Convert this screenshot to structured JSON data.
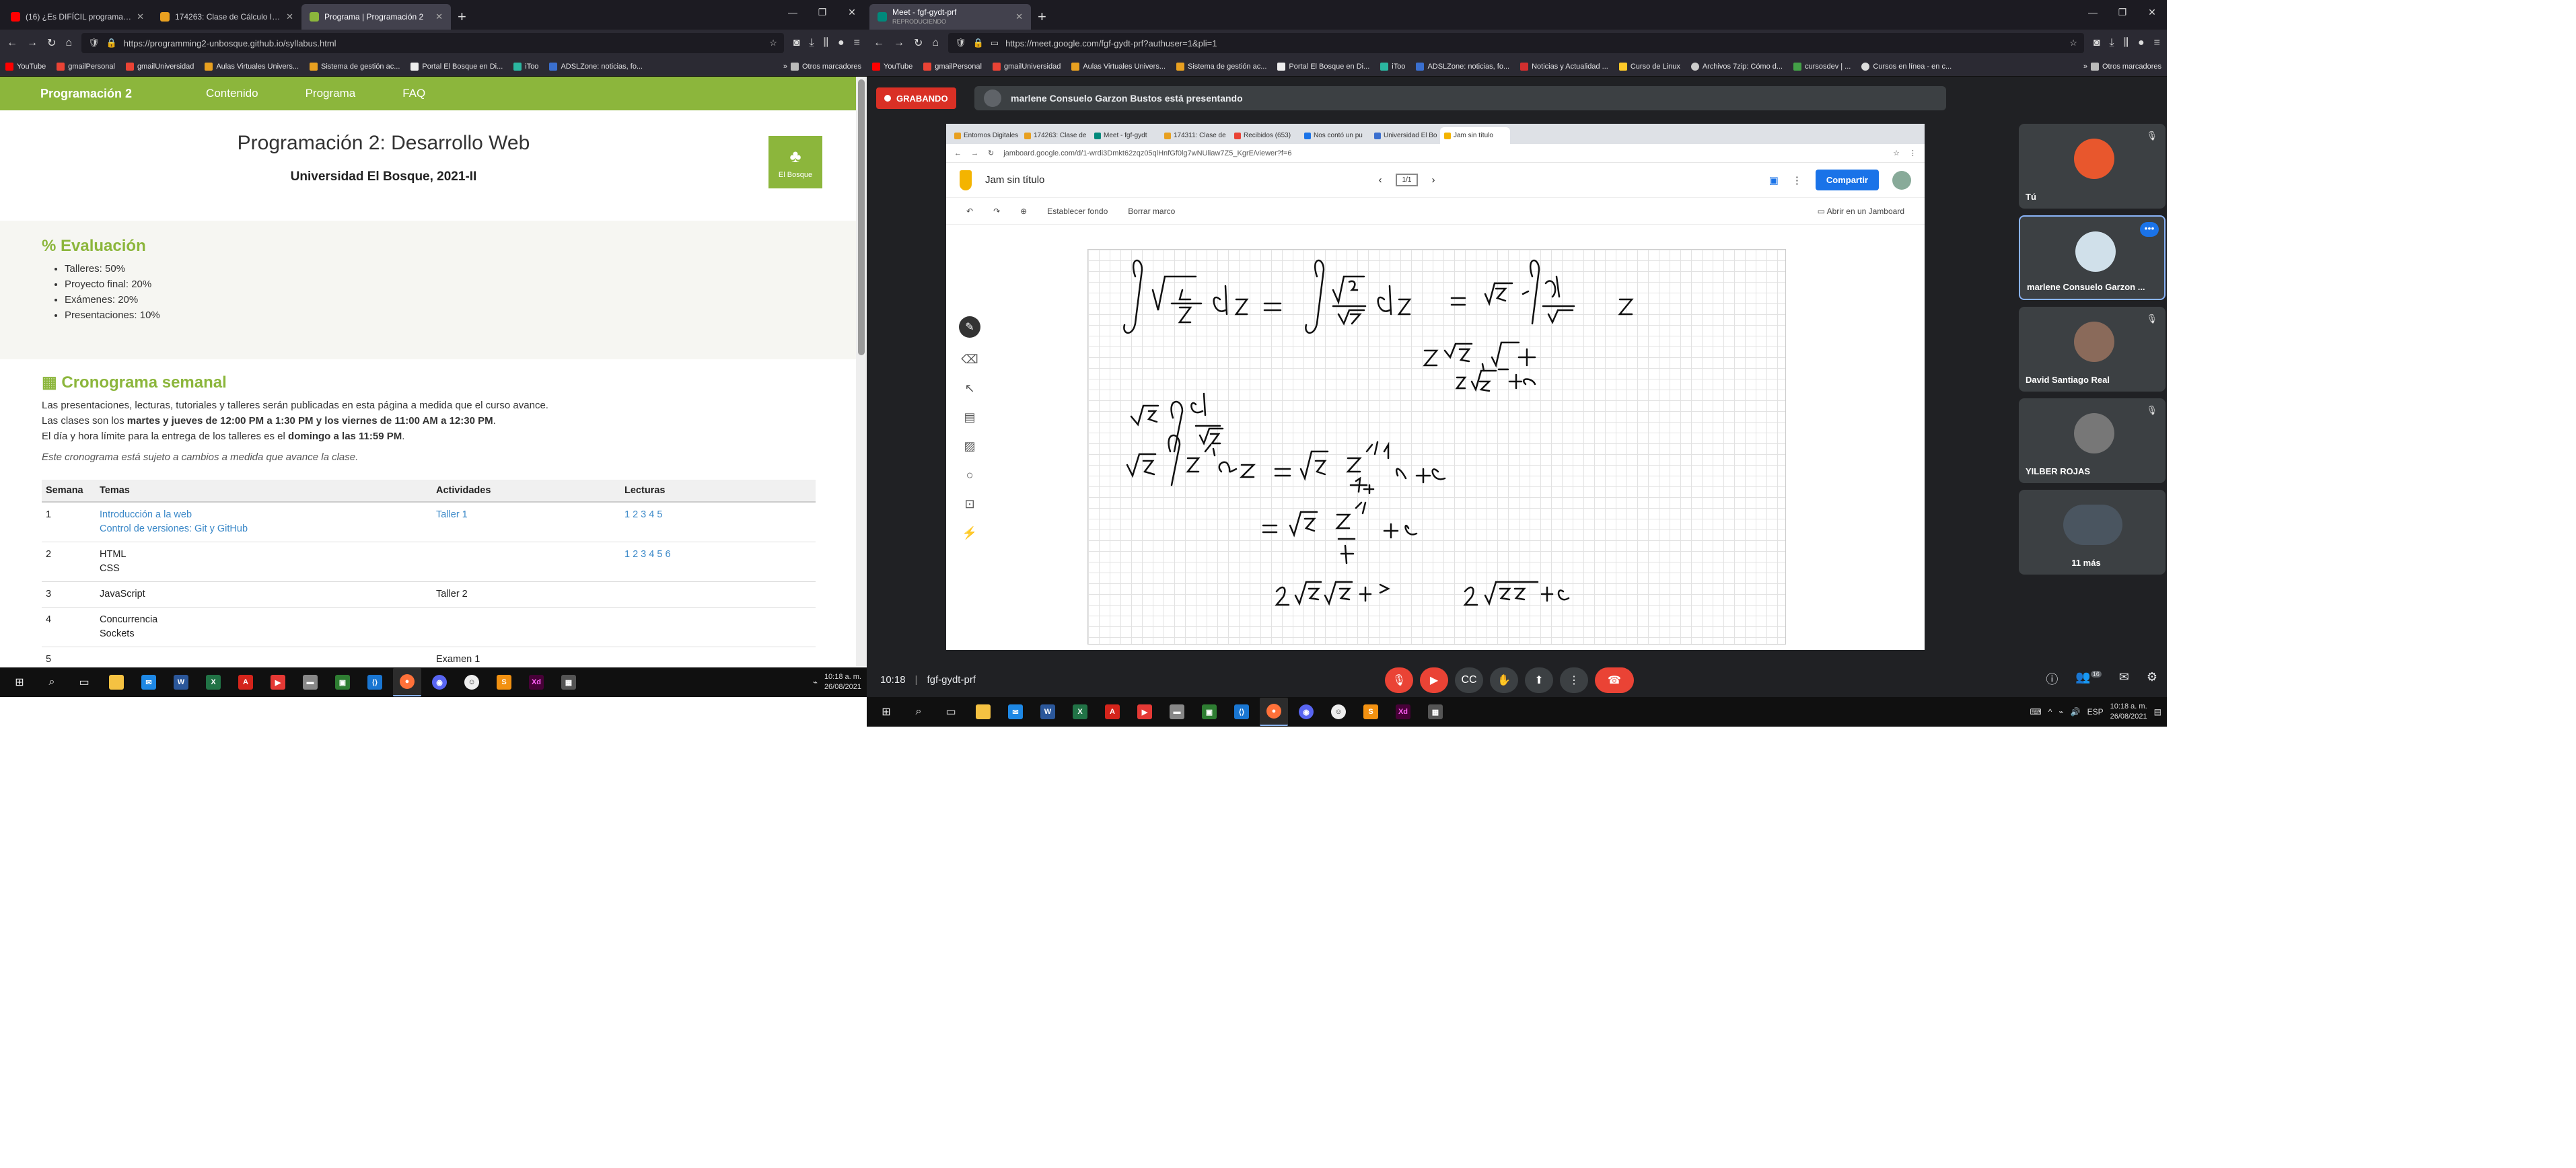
{
  "left_browser": {
    "tabs": [
      {
        "label": "(16) ¿Es DIFÍCIL programar? - YouTube",
        "color": "#ff0000"
      },
      {
        "label": "174263: Clase de Cálculo Integral",
        "color": "#e8a020"
      },
      {
        "label": "Programa | Programación 2",
        "color": "#8cb63c",
        "active": true
      }
    ],
    "url": "https://programming2-unbosque.github.io/syllabus.html",
    "bookmarks": [
      "YouTube",
      "gmailPersonal",
      "gmailUniversidad",
      "Aulas Virtuales Univers...",
      "Sistema de gestión ac...",
      "Portal El Bosque en Di...",
      "iToo",
      "ADSLZone: noticias, fo..."
    ],
    "bookmarks_more": "Otros marcadores"
  },
  "site": {
    "brand": "Programación 2",
    "nav": [
      "Contenido",
      "Programa",
      "FAQ"
    ],
    "title": "Programación 2: Desarrollo Web",
    "subtitle": "Universidad El Bosque, 2021-II",
    "logo_text": "El Bosque",
    "eval_heading": "Evaluación",
    "eval_items": [
      "Talleres: 50%",
      "Proyecto final: 20%",
      "Exámenes: 20%",
      "Presentaciones: 10%"
    ],
    "crono_heading": "Cronograma semanal",
    "p1": "Las presentaciones, lecturas, tutoriales y talleres serán publicadas en esta página a medida que el curso avance.",
    "p2a": "Las clases son los ",
    "p2b": "martes y jueves de 12:00 PM a 1:30 PM y los viernes de 11:00 AM a 12:30 PM",
    "p2c": ".",
    "p3a": "El día y hora límite para la entrega de los talleres es el ",
    "p3b": "domingo a las 11:59 PM",
    "p3c": ".",
    "note": "Este cronograma está sujeto a cambios a medida que avance la clase.",
    "table_headers": [
      "Semana",
      "Temas",
      "Actividades",
      "Lecturas"
    ],
    "rows": [
      {
        "semana": "1",
        "temas": [
          "Introducción a la web",
          "Control de versiones: Git y GitHub"
        ],
        "link": true,
        "actividad": "Taller 1",
        "act_link": true,
        "lecturas": "1 2 3 4 5"
      },
      {
        "semana": "2",
        "temas": [
          "HTML",
          "CSS"
        ],
        "link": false,
        "actividad": "",
        "act_link": false,
        "lecturas": "1 2 3 4 5 6"
      },
      {
        "semana": "3",
        "temas": [
          "JavaScript"
        ],
        "link": false,
        "actividad": "Taller 2",
        "act_link": false,
        "lecturas": ""
      },
      {
        "semana": "4",
        "temas": [
          "Concurrencia",
          "Sockets"
        ],
        "link": false,
        "actividad": "",
        "act_link": false,
        "lecturas": ""
      },
      {
        "semana": "5",
        "temas": [],
        "link": false,
        "actividad": "Examen 1",
        "act_link": false,
        "lecturas": ""
      }
    ]
  },
  "left_taskbar": {
    "time": "10:18 a. m.",
    "date": "26/08/2021"
  },
  "right_browser": {
    "tab": "Meet - fgf-gydt-prf",
    "tab_sub": "REPRODUCIENDO",
    "url": "https://meet.google.com/fgf-gydt-prf?authuser=1&pli=1",
    "bookmarks": [
      "YouTube",
      "gmailPersonal",
      "gmailUniversidad",
      "Aulas Virtuales Univers...",
      "Sistema de gestión ac...",
      "Portal El Bosque en Di...",
      "iToo",
      "ADSLZone: noticias, fo...",
      "Noticias y Actualidad ...",
      "Curso de Linux",
      "Archivos 7zip: Cómo d...",
      "cursosdev | ...",
      "Cursos en línea - en c..."
    ],
    "bookmarks_more": "Otros marcadores"
  },
  "meet": {
    "recording": "GRABANDO",
    "presenting": "marlene Consuelo Garzon Bustos está presentando",
    "time": "10:18",
    "code": "fgf-gydt-prf",
    "participants_badge": "16",
    "participants": [
      {
        "name": "Tú",
        "color": "#e8572d",
        "mic": "🎙",
        "highlight": false
      },
      {
        "name": "marlene Consuelo Garzon ...",
        "color": "#d0e0ea",
        "mic": "",
        "highlight": true
      },
      {
        "name": "David Santiago Real",
        "color": "#8a6a5a",
        "mic": "🎙",
        "highlight": false
      },
      {
        "name": "YILBER ROJAS",
        "color": "#777777",
        "mic": "🎙",
        "highlight": false
      },
      {
        "name": "11 más",
        "color": "#4a5560",
        "mic": "",
        "highlight": false
      }
    ]
  },
  "jamboard": {
    "tabs": [
      "Entornos Digitales",
      "174263: Clase de",
      "Meet - fgf-gydt",
      "174311: Clase de",
      "Recibidos (653)",
      "Nos contó un pu",
      "Universidad El Bo",
      "Jam sin título"
    ],
    "url": "jamboard.google.com/d/1-wrdi3Dmkt62zqz05qlHnfGf0lg7wNUliaw7Z5_KgrE/viewer?f=6",
    "title": "Jam sin título",
    "share": "Compartir",
    "set_bg": "Establecer fondo",
    "clear": "Borrar marco",
    "open": "Abrir en un Jamboard",
    "frame": "1/1"
  },
  "right_taskbar": {
    "time": "10:18 a. m.",
    "date": "26/08/2021"
  }
}
